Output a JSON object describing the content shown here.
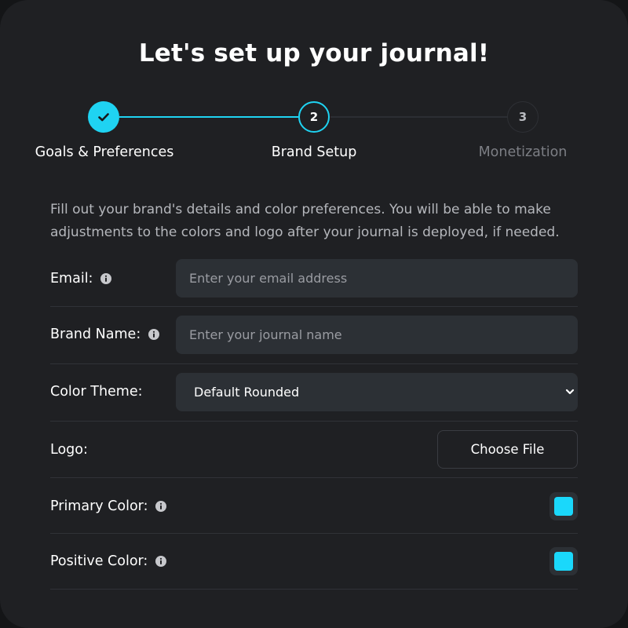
{
  "header": {
    "title": "Let's set up your journal!"
  },
  "stepper": {
    "steps": [
      {
        "label": "Goals & Preferences",
        "number": "1",
        "state": "complete"
      },
      {
        "label": "Brand Setup",
        "number": "2",
        "state": "active"
      },
      {
        "label": "Monetization",
        "number": "3",
        "state": "pending"
      }
    ],
    "accent_color": "#1fd3f2"
  },
  "intro": {
    "text": "Fill out your brand's details and color preferences. You will be able to make adjustments to the colors and logo after your journal is deployed, if needed."
  },
  "form": {
    "email": {
      "label": "Email:",
      "placeholder": "Enter your email address",
      "value": ""
    },
    "brand_name": {
      "label": "Brand Name:",
      "placeholder": "Enter your journal name",
      "value": ""
    },
    "color_theme": {
      "label": "Color Theme:",
      "selected": "Default Rounded"
    },
    "logo": {
      "label": "Logo:",
      "button_label": "Choose File"
    },
    "primary_color": {
      "label": "Primary Color:",
      "color": "#1ad8fb"
    },
    "positive_color": {
      "label": "Positive Color:",
      "color": "#1ad8fb"
    }
  }
}
